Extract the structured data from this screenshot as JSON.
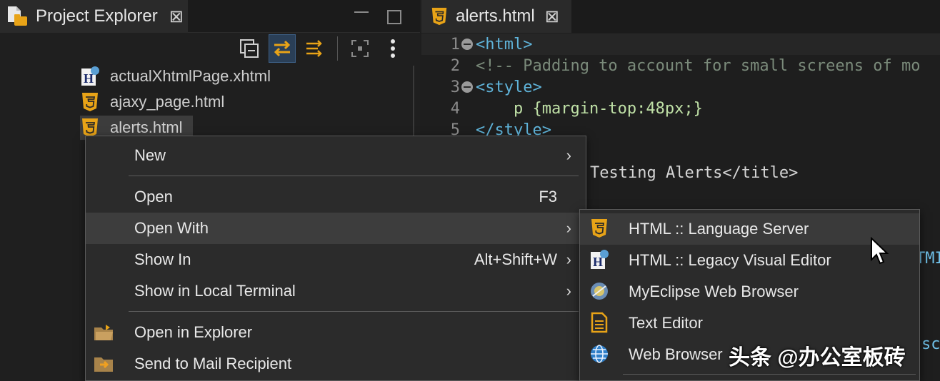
{
  "explorer": {
    "tab_title": "Project Explorer",
    "files": [
      {
        "name": "actualXhtmlPage.xhtml",
        "icon": "xhtml-file-icon"
      },
      {
        "name": "ajaxy_page.html",
        "icon": "html5-file-icon"
      },
      {
        "name": "alerts.html",
        "icon": "html5-file-icon",
        "selected": true
      }
    ]
  },
  "editor": {
    "tab_title": "alerts.html",
    "lines": [
      {
        "num": "1",
        "text": "<html>"
      },
      {
        "num": "2",
        "text": "<!-- Padding to account for small screens of mo"
      },
      {
        "num": "3",
        "text": "<style>"
      },
      {
        "num": "4",
        "text": "    p {margin-top:48px;}"
      },
      {
        "num": "5",
        "text": "</style>"
      },
      {
        "num": "",
        "text": "Testing Alerts</title>"
      }
    ],
    "partial_right_text": "TMI",
    "partial_right_text2": "sc"
  },
  "context_menu": {
    "items": [
      {
        "label": "New",
        "submenu": true
      },
      {
        "label": "Open",
        "shortcut": "F3"
      },
      {
        "label": "Open With",
        "submenu": true,
        "highlighted": true
      },
      {
        "label": "Show In",
        "shortcut": "Alt+Shift+W",
        "submenu": true
      },
      {
        "label": "Show in Local Terminal",
        "submenu": true
      },
      {
        "label": "Open in Explorer",
        "icon": "folder-open-icon"
      },
      {
        "label": "Send to Mail Recipient",
        "icon": "folder-send-icon"
      }
    ]
  },
  "open_with_submenu": {
    "items": [
      {
        "label": "HTML :: Language Server",
        "icon": "html5-icon",
        "highlighted": true
      },
      {
        "label": "HTML :: Legacy Visual Editor",
        "icon": "html-editor-icon"
      },
      {
        "label": "MyEclipse Web Browser",
        "icon": "myeclipse-browser-icon"
      },
      {
        "label": "Text Editor",
        "icon": "text-file-icon"
      },
      {
        "label": "Web Browser",
        "icon": "globe-icon"
      }
    ]
  },
  "watermark": "头条 @办公室板砖",
  "colors": {
    "html5_orange": "#e8a317",
    "accent_blue": "#3d5f85",
    "menu_bg": "#2b2b2b",
    "tag_blue": "#5fb3d9"
  }
}
